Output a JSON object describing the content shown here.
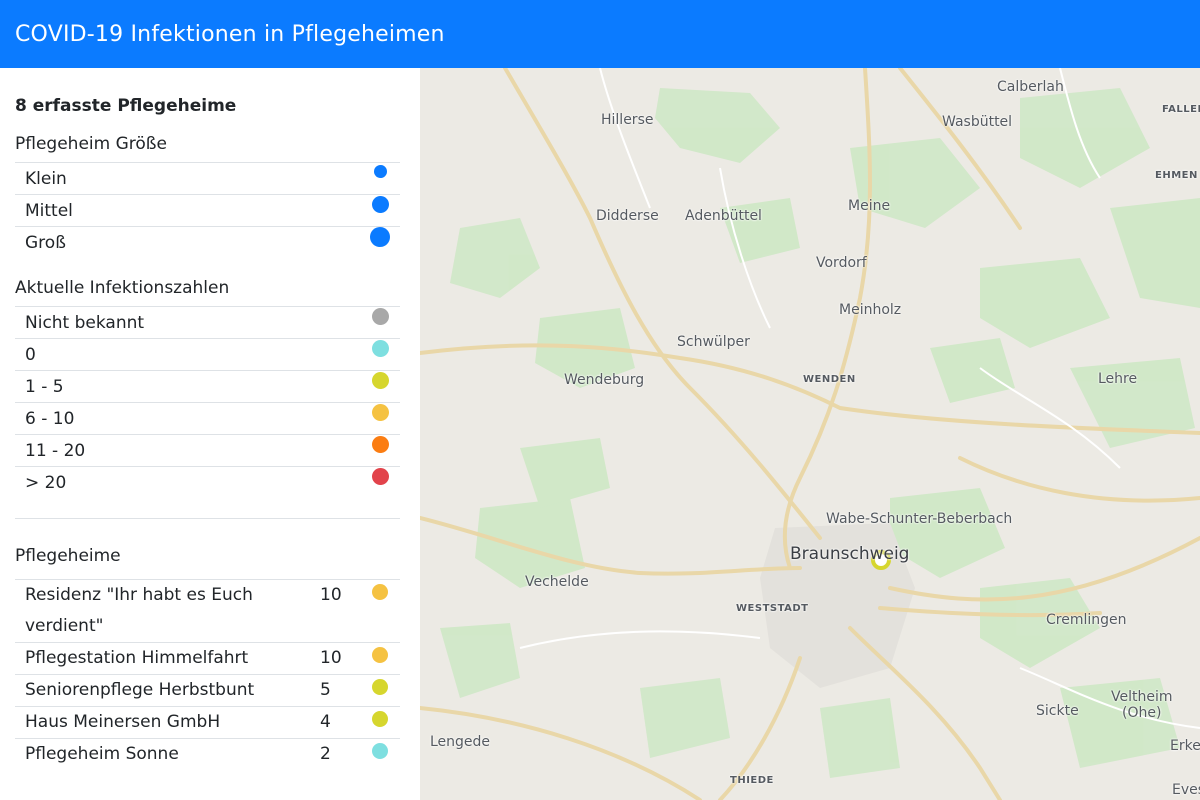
{
  "app": {
    "title": "COVID-19 Infektionen in Pflegeheimen"
  },
  "sidebar": {
    "count_title": "8 erfasste Pflegeheime",
    "size_section": {
      "title": "Pflegeheim Größe",
      "items": [
        {
          "label": "Klein",
          "color": "#0b7bff",
          "size": "small"
        },
        {
          "label": "Mittel",
          "color": "#0b7bff",
          "size": "medium"
        },
        {
          "label": "Groß",
          "color": "#0b7bff",
          "size": "large"
        }
      ]
    },
    "infection_section": {
      "title": "Aktuelle Infektionszahlen",
      "items": [
        {
          "label": "Nicht bekannt",
          "color": "#a8a8a8"
        },
        {
          "label": "0",
          "color": "#7edfe0"
        },
        {
          "label": "1 - 5",
          "color": "#d6d62e"
        },
        {
          "label": "6 - 10",
          "color": "#f5c242"
        },
        {
          "label": "11 - 20",
          "color": "#fb7d12"
        },
        {
          "label": "> 20",
          "color": "#e2434b"
        }
      ]
    },
    "homes_section": {
      "title": "Pflegeheime",
      "items": [
        {
          "name": "Residenz \"Ihr habt es Euch verdient\"",
          "count": "10",
          "color": "#f5c242"
        },
        {
          "name": "Pflegestation Himmelfahrt",
          "count": "10",
          "color": "#f5c242"
        },
        {
          "name": "Seniorenpflege Herbstbunt",
          "count": "5",
          "color": "#d6d62e"
        },
        {
          "name": "Haus Meinersen GmbH",
          "count": "4",
          "color": "#d6d62e"
        },
        {
          "name": "Pflegeheim Sonne",
          "count": "2",
          "color": "#7edfe0"
        }
      ]
    }
  },
  "map": {
    "places": {
      "calberlah": "Calberlah",
      "hillerse": "Hillerse",
      "wasbuettel": "Wasbüttel",
      "fallersleben": "FALLER",
      "ehmen": "EHMEN",
      "didderse": "Didderse",
      "adenbuettel": "Adenbüttel",
      "meine": "Meine",
      "vordorf": "Vordorf",
      "meinholz": "Meinholz",
      "schwuelper": "Schwülper",
      "wendeburg": "Wendeburg",
      "wenden": "WENDEN",
      "lehre": "Lehre",
      "wabe": "Wabe-Schunter-Beberbach",
      "braunschweig": "Braunschweig",
      "vechelde": "Vechelde",
      "weststadt": "WESTSTADT",
      "cremlingen": "Cremlingen",
      "veltheim": "Veltheim",
      "ohe": "(Ohe)",
      "sickte": "Sickte",
      "lengede": "Lengede",
      "erkerode": "Erker",
      "thiede": "THIEDE",
      "evessen": "Eves"
    },
    "marker_color": "#d6d62e"
  }
}
